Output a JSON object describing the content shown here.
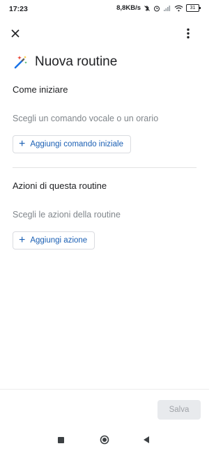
{
  "status_bar": {
    "time": "17:23",
    "speed": "8,8KB/s",
    "battery": "31"
  },
  "page": {
    "title": "Nuova routine"
  },
  "start_section": {
    "title": "Come iniziare",
    "hint": "Scegli un comando vocale o un orario",
    "button_label": "Aggiungi comando iniziale"
  },
  "actions_section": {
    "title": "Azioni di questa routine",
    "hint": "Scegli le azioni della routine",
    "button_label": "Aggiungi azione"
  },
  "footer": {
    "save_label": "Salva"
  },
  "icons": {
    "close": "close-icon",
    "menu": "more-vert-icon",
    "title": "magic-wand-icon",
    "add": "plus-icon"
  },
  "colors": {
    "accent": "#1a5fb4",
    "hint": "#80868b",
    "disabled_bg": "#e8eaed"
  }
}
